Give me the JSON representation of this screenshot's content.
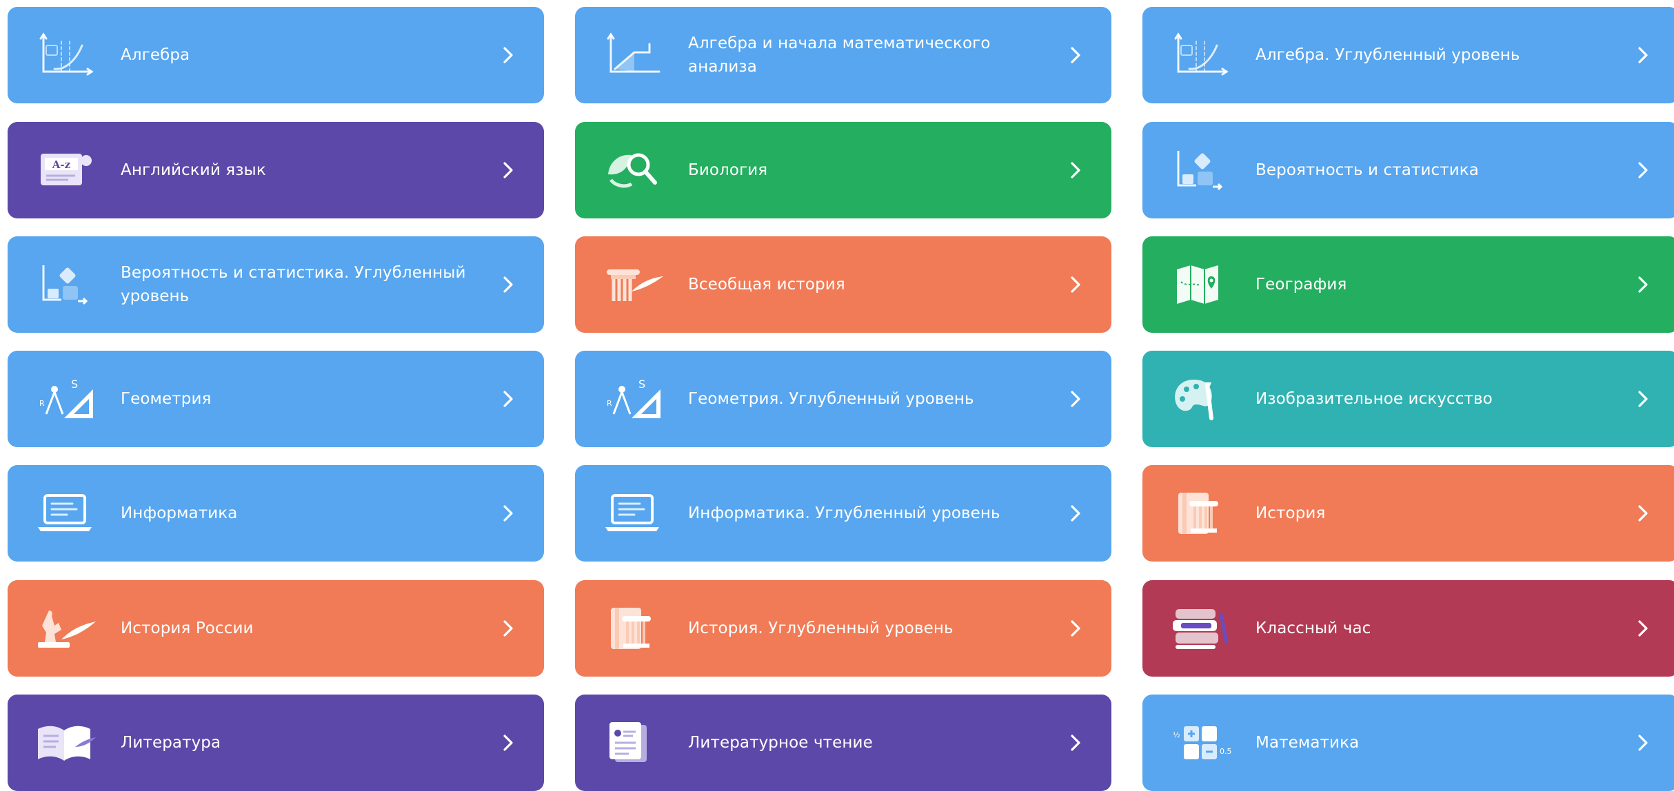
{
  "subjects": [
    {
      "label": "Алгебра",
      "icon": "algebra-graph-icon",
      "color": "#57a6ef"
    },
    {
      "label": "Алгебра и начала математического анализа",
      "icon": "calculus-graph-icon",
      "color": "#57a6ef"
    },
    {
      "label": "Алгебра. Углубленный уровень",
      "icon": "algebra-graph-icon",
      "color": "#57a6ef"
    },
    {
      "label": "Английский язык",
      "icon": "dictionary-az-icon",
      "color": "#5c48a8"
    },
    {
      "label": "Биология",
      "icon": "magnifier-leaf-icon",
      "color": "#24ae5f"
    },
    {
      "label": "Вероятность и статистика",
      "icon": "dice-chart-icon",
      "color": "#57a6ef"
    },
    {
      "label": "Вероятность и статистика. Углубленный уровень",
      "icon": "dice-chart-icon",
      "color": "#57a6ef"
    },
    {
      "label": "Всеобщая история",
      "icon": "column-quill-icon",
      "color": "#f07b56"
    },
    {
      "label": "География",
      "icon": "map-pin-icon",
      "color": "#24ae5f"
    },
    {
      "label": "Геометрия",
      "icon": "compass-ruler-icon",
      "color": "#57a6ef"
    },
    {
      "label": "Геометрия. Углубленный уровень",
      "icon": "compass-ruler-icon",
      "color": "#57a6ef"
    },
    {
      "label": "Изобразительное искусство",
      "icon": "palette-brush-icon",
      "color": "#30b2b2"
    },
    {
      "label": "Информатика",
      "icon": "laptop-icon",
      "color": "#57a6ef"
    },
    {
      "label": "Информатика. Углубленный уровень",
      "icon": "laptop-icon",
      "color": "#57a6ef"
    },
    {
      "label": "История",
      "icon": "book-column-icon",
      "color": "#f07b56"
    },
    {
      "label": "История России",
      "icon": "monument-quill-icon",
      "color": "#f07b56"
    },
    {
      "label": "История. Углубленный уровень",
      "icon": "book-column-icon",
      "color": "#f07b56"
    },
    {
      "label": "Классный час",
      "icon": "books-pencil-icon",
      "color": "#b33a54"
    },
    {
      "label": "Литература",
      "icon": "open-book-icon",
      "color": "#5c48a8"
    },
    {
      "label": "Литературное чтение",
      "icon": "reading-book-icon",
      "color": "#5c48a8"
    },
    {
      "label": "Математика",
      "icon": "calculator-tiles-icon",
      "color": "#57a6ef"
    }
  ]
}
